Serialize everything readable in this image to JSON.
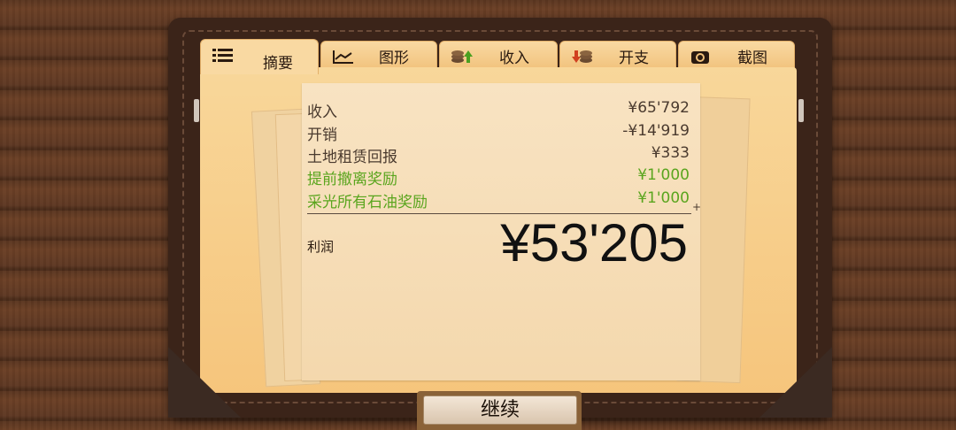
{
  "tabs": [
    {
      "label": "摘要",
      "icon": "list-icon",
      "active": true
    },
    {
      "label": "图形",
      "icon": "chart-icon",
      "active": false
    },
    {
      "label": "收入",
      "icon": "coins-up-icon",
      "active": false
    },
    {
      "label": "开支",
      "icon": "coins-down-icon",
      "active": false
    },
    {
      "label": "截图",
      "icon": "camera-icon",
      "active": false
    }
  ],
  "summary": {
    "rows": [
      {
        "label": "收入",
        "value": "¥65'792",
        "highlight": false
      },
      {
        "label": "开销",
        "value": "-¥14'919",
        "highlight": false
      },
      {
        "label": "土地租赁回报",
        "value": "¥333",
        "highlight": false
      },
      {
        "label": "提前撤离奖励",
        "value": "¥1'000",
        "highlight": true
      },
      {
        "label": "采光所有石油奖励",
        "value": "¥1'000",
        "highlight": true
      }
    ],
    "plus_sign": "+",
    "profit_label": "利润",
    "profit_value": "¥53'205"
  },
  "continue_button": "继续",
  "colors": {
    "highlight": "#5aa51e",
    "folder": "#f6c57c",
    "binder": "#3b2419"
  }
}
